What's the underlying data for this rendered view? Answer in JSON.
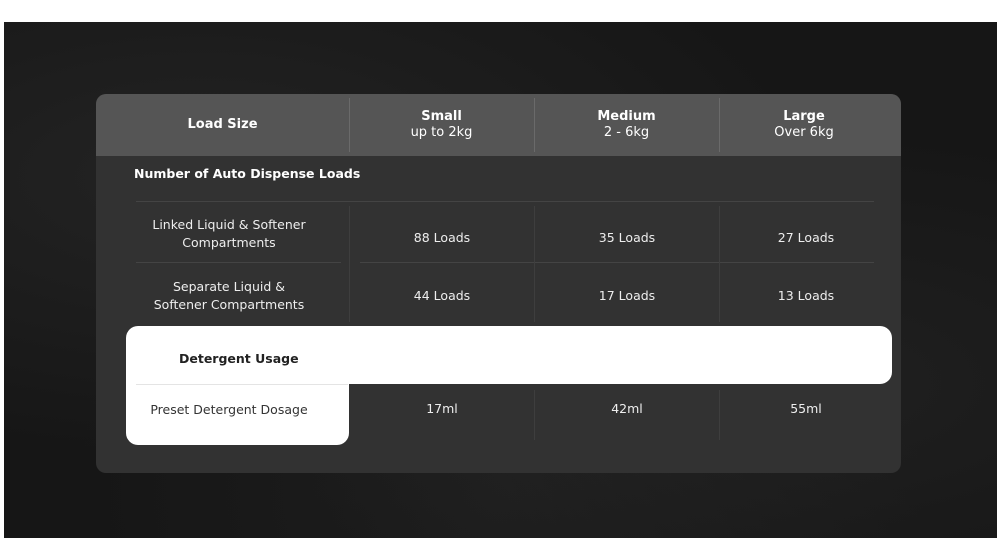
{
  "table": {
    "header": {
      "load_size": "Load Size",
      "columns": [
        {
          "title": "Small",
          "subtitle": "up to 2kg"
        },
        {
          "title": "Medium",
          "subtitle": "2 - 6kg"
        },
        {
          "title": "Large",
          "subtitle": "Over 6kg"
        }
      ]
    },
    "sections": [
      {
        "title": "Number of Auto Dispense Loads",
        "rows": [
          {
            "label": "Linked Liquid & Softener Compartments",
            "values": [
              "88 Loads",
              "35 Loads",
              "27 Loads"
            ]
          },
          {
            "label": "Separate Liquid & Softener Compartments",
            "values": [
              "44 Loads",
              "17 Loads",
              "13 Loads"
            ]
          }
        ]
      },
      {
        "title": "Detergent Usage",
        "rows": [
          {
            "label": "Preset Detergent Dosage",
            "values": [
              "17ml",
              "42ml",
              "55ml"
            ]
          }
        ]
      }
    ]
  },
  "colors": {
    "background": "#161616",
    "card": "#323232",
    "header": "#555555",
    "highlight": "#ffffff"
  }
}
